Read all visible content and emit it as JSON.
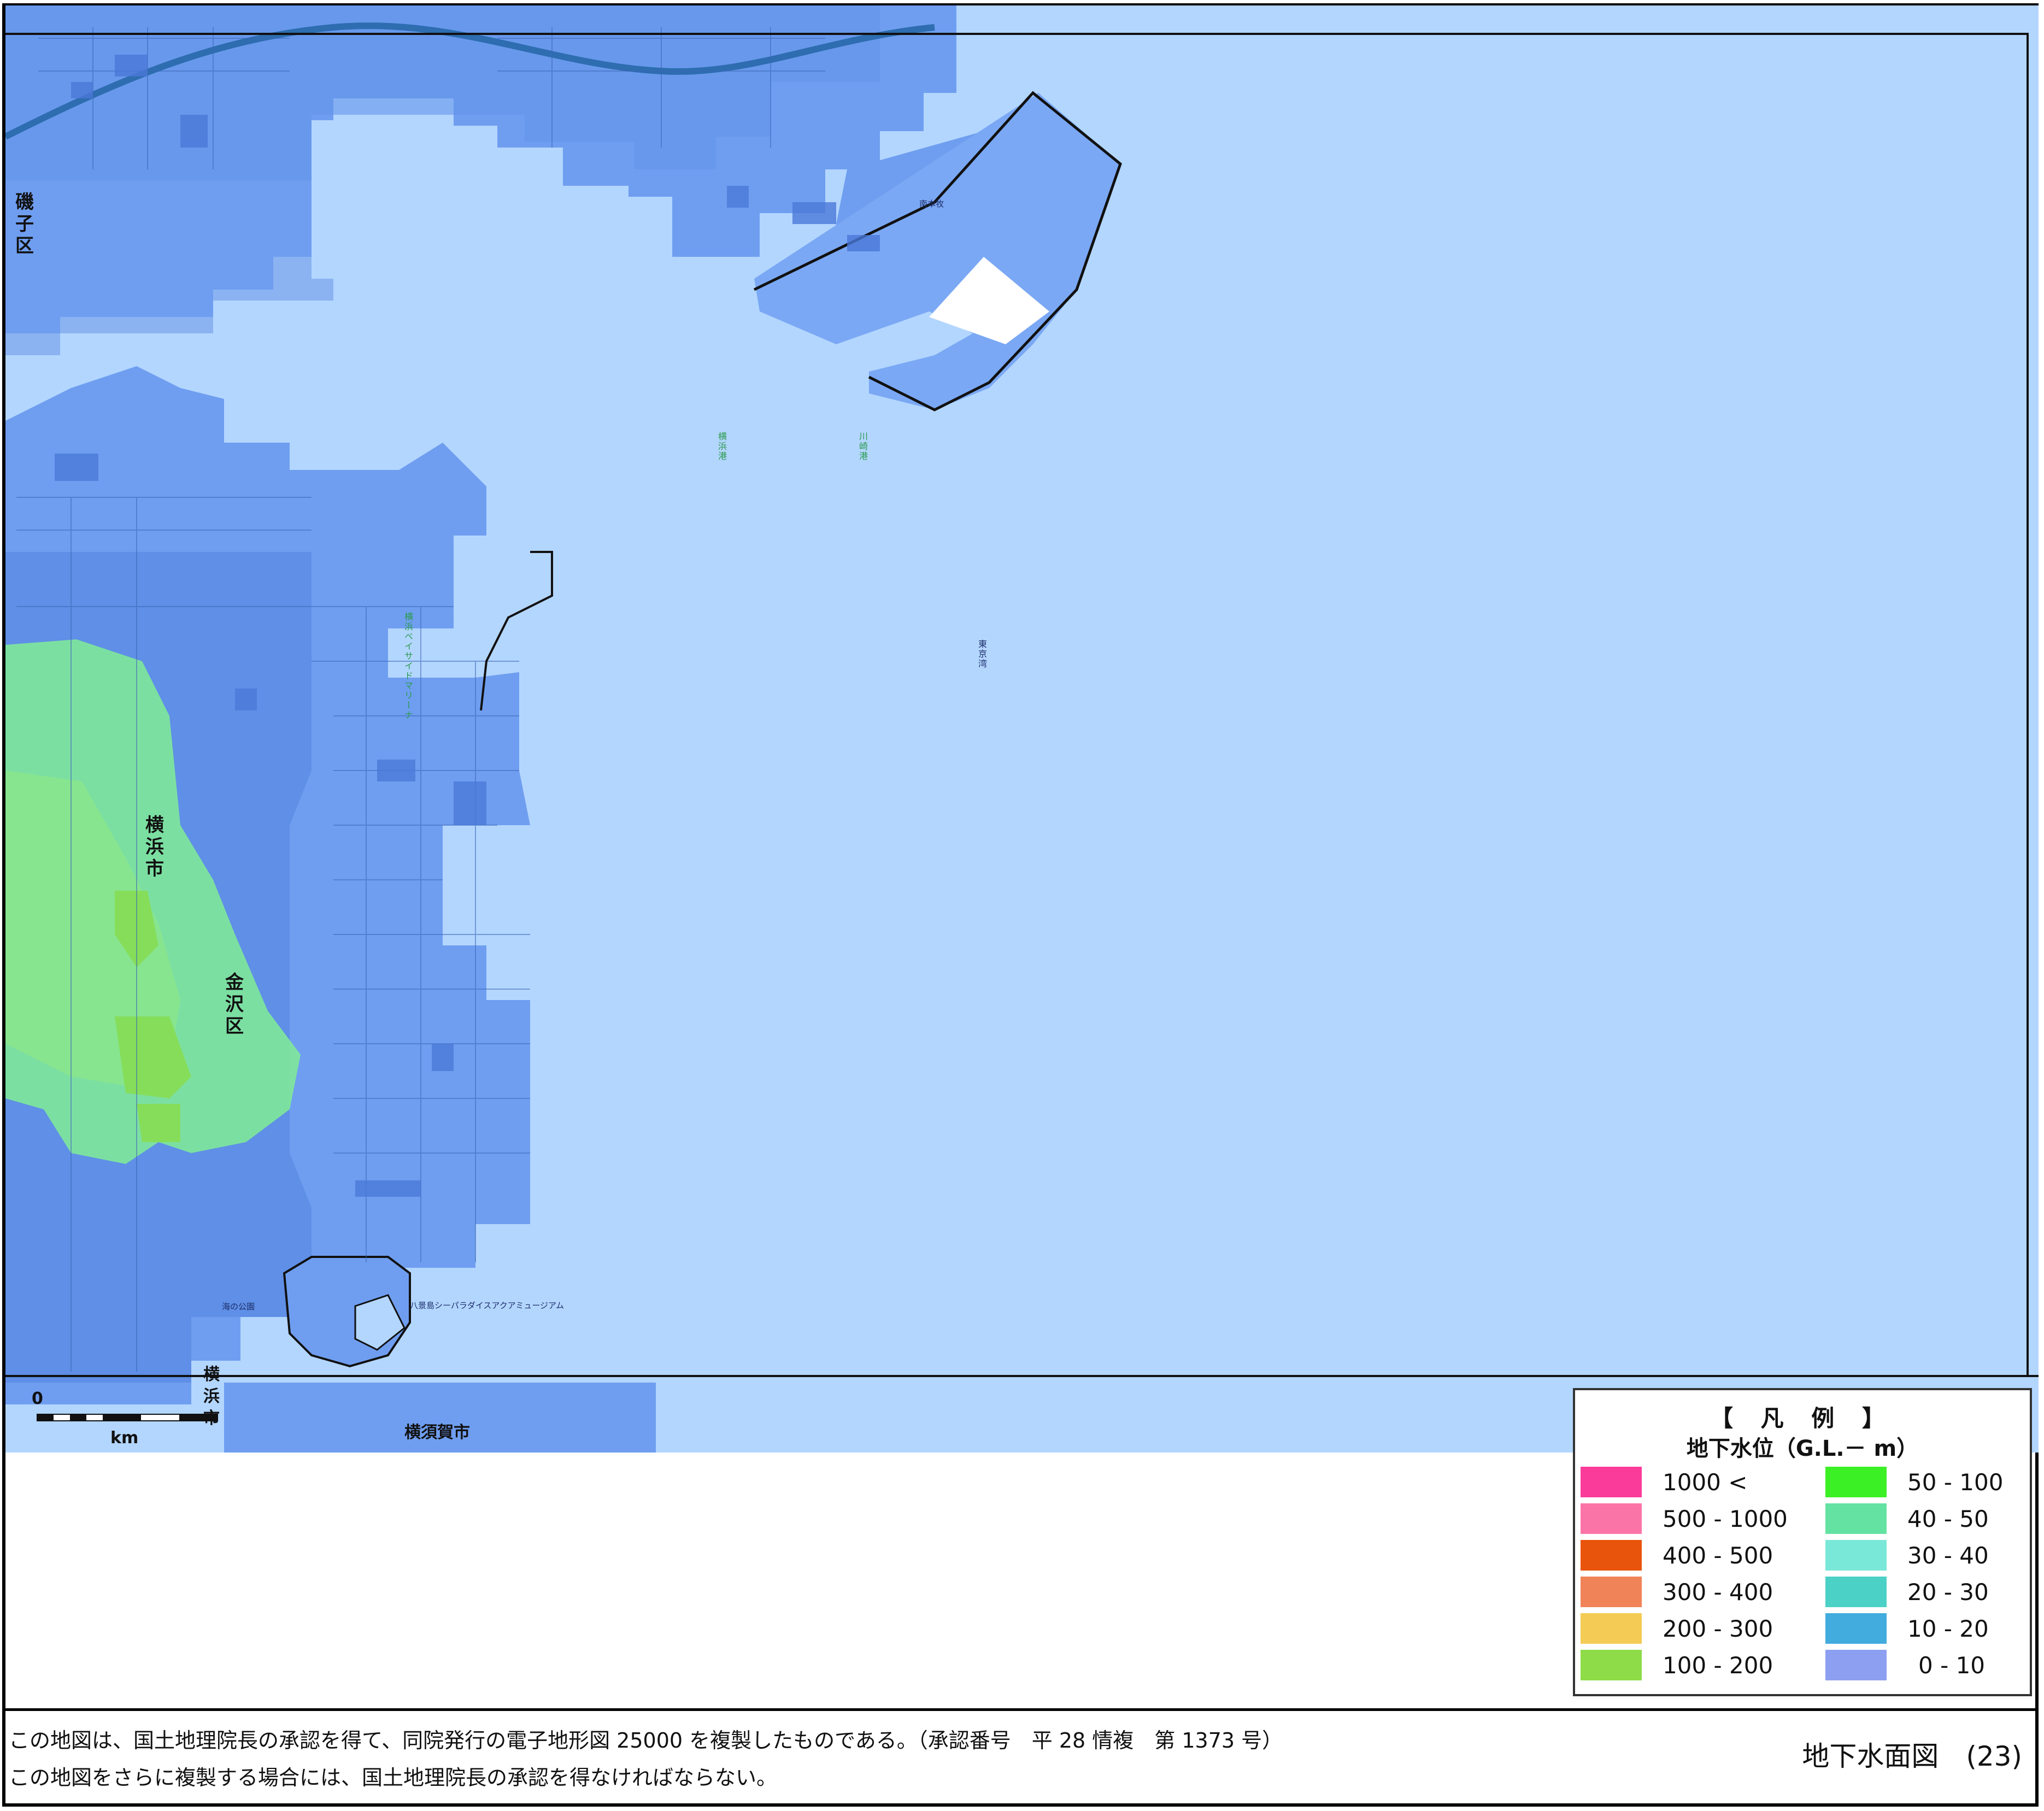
{
  "map": {
    "sea_labels": [
      {
        "text": "横浜港"
      },
      {
        "text": "川崎港"
      },
      {
        "text": "東京湾"
      }
    ],
    "place_labels": [
      {
        "text": "八景島シーパラダイスアクアミュージアム"
      },
      {
        "text": "海の公園"
      },
      {
        "text": "横浜ベイサイドマリーナ"
      },
      {
        "text": "南本牧"
      }
    ],
    "ward_labels": {
      "isogo": "磯子区",
      "yokohama": "横浜市",
      "kanazawa": "金沢区",
      "yokosuka": "横須賀市",
      "yokohama_south": "横浜市"
    },
    "scale_bar": {
      "zero_label": "0",
      "unit_label": "km"
    },
    "colors": {
      "sea": "#b3d6ff",
      "land": "#6f9ef0",
      "land_dark": "#4f82dc",
      "green": "#7fe89a",
      "green_strong": "#86dd5a"
    }
  },
  "legend": {
    "title": "【 凡 例 】",
    "subtitle": "地下水位（G.L.－ m）",
    "items": [
      {
        "label": "1000 <",
        "color": "#fb3b9a"
      },
      {
        "label": "500 - 1000",
        "color": "#fb74a8"
      },
      {
        "label": "400 - 500",
        "color": "#e8540c"
      },
      {
        "label": "300 - 400",
        "color": "#f08358"
      },
      {
        "label": "200 - 300",
        "color": "#f4cc55"
      },
      {
        "label": "100 - 200",
        "color": "#8ddc48"
      },
      {
        "label": "50 - 100",
        "color": "#3cf026"
      },
      {
        "label": "40 - 50",
        "color": "#64e2a2"
      },
      {
        "label": "30 - 40",
        "color": "#7ae8d8"
      },
      {
        "label": "20 - 30",
        "color": "#4cd1c6"
      },
      {
        "label": "10 - 20",
        "color": "#41acdd"
      },
      {
        "label": "0 - 10",
        "color": "#8d9ff0"
      }
    ]
  },
  "footer": {
    "note_line1": "この地図は、国土地理院長の承認を得て、同院発行の電子地形図 25000 を複製したものである。（承認番号　平 28 情複　第 1373 号）",
    "note_line2": "この地図をさらに複製する場合には、国土地理院長の承認を得なければならない。",
    "figure_title": "地下水面図　(23)"
  }
}
